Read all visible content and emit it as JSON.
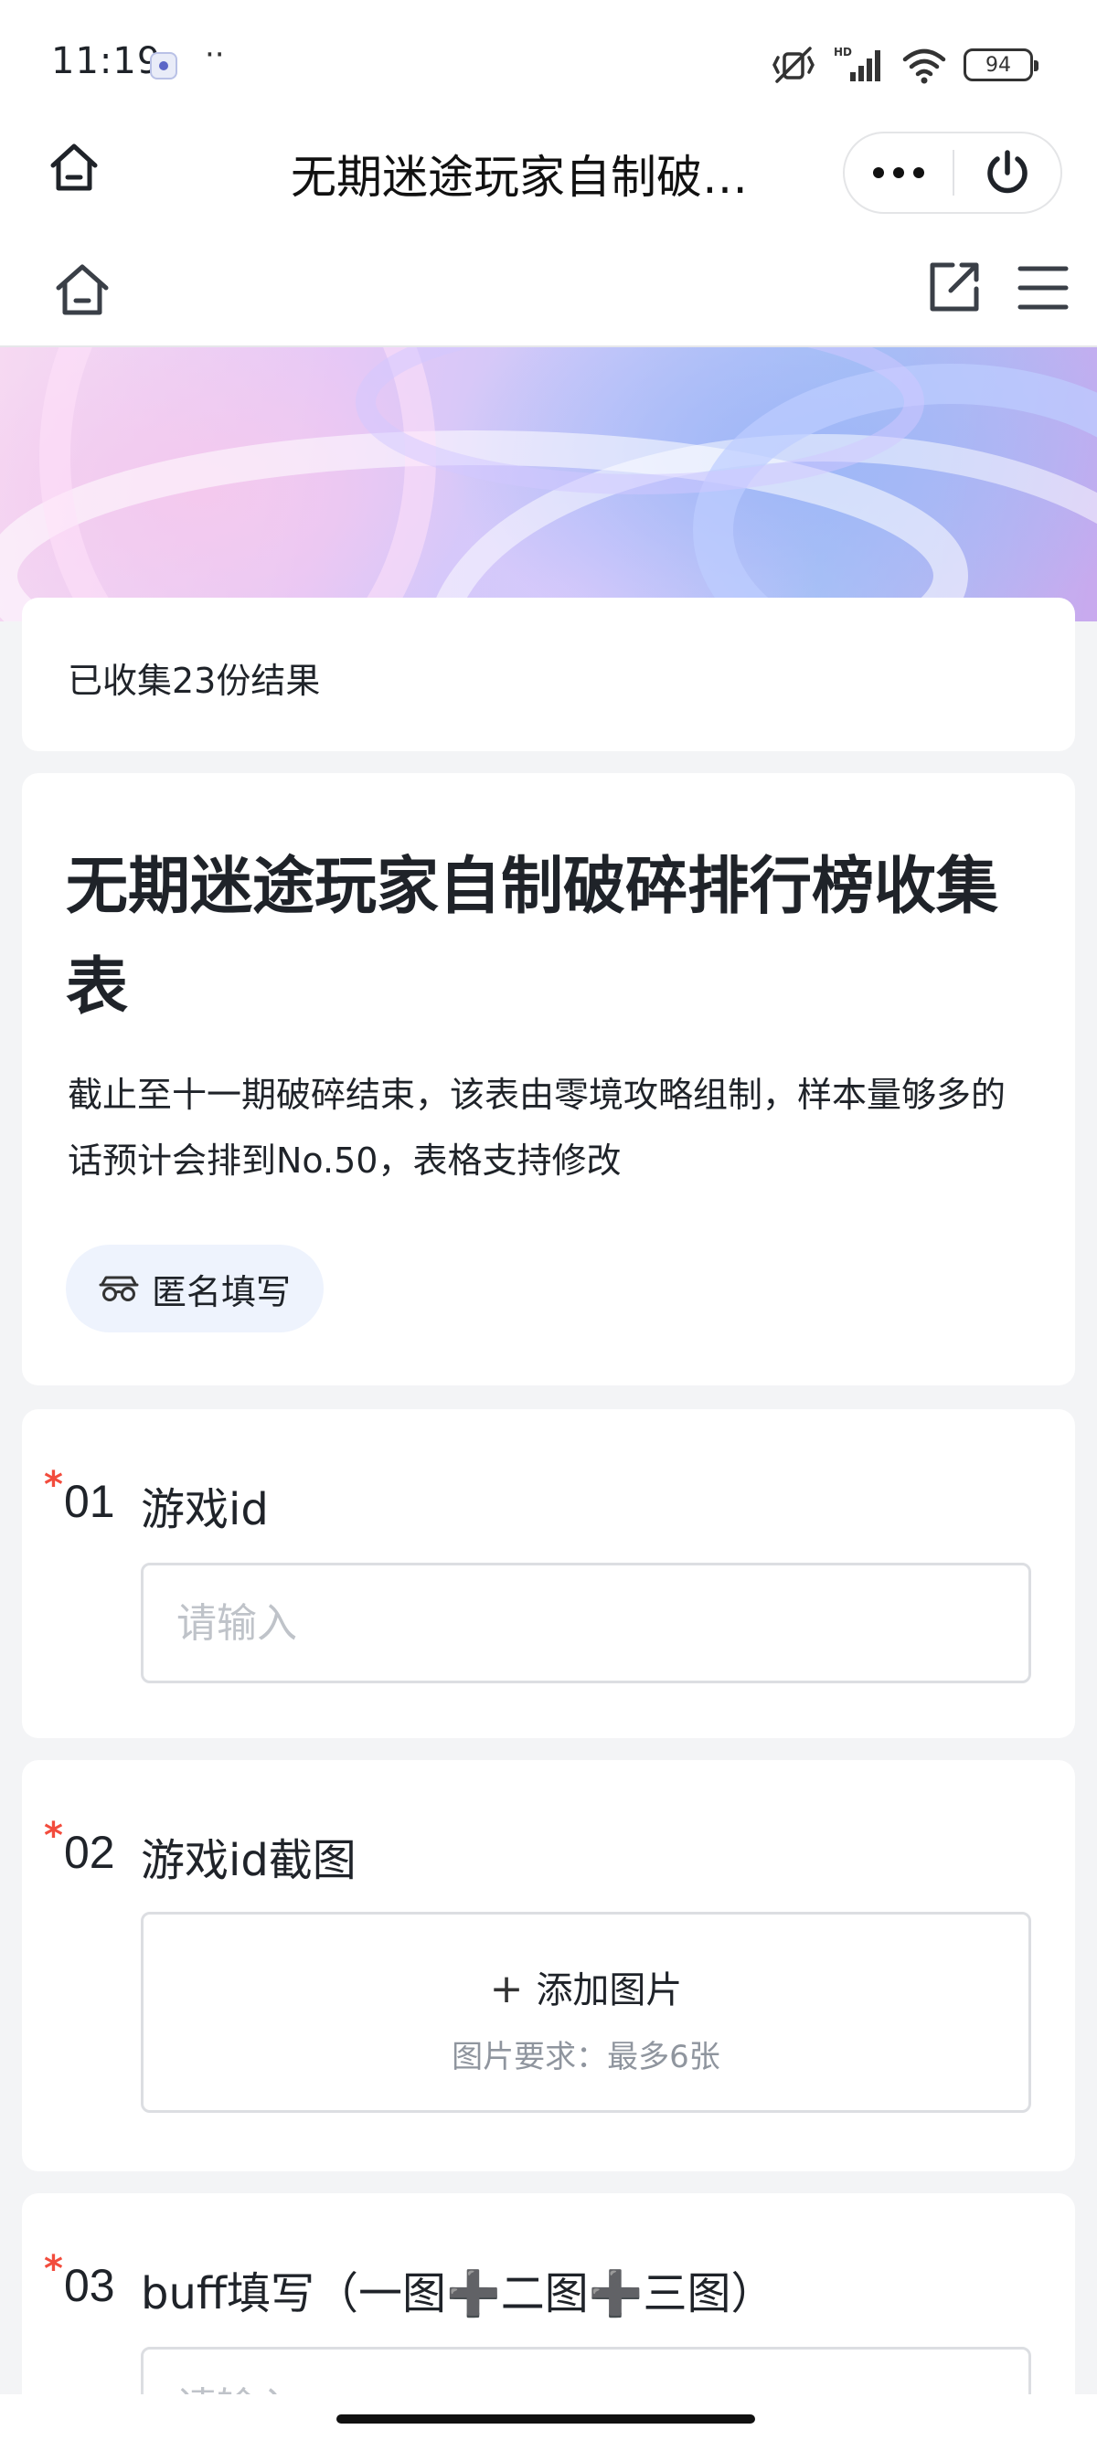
{
  "status_bar": {
    "time": "11:19",
    "dots": "··",
    "battery": "94"
  },
  "nav": {
    "title": "无期迷途玩家自制破…"
  },
  "banner": {
    "colors": [
      "#f6d9f2",
      "#c7c9fa",
      "#aac4f6"
    ]
  },
  "form": {
    "count_text": "已收集23份结果",
    "title": "无期迷途玩家自制破碎排行榜收集表",
    "description": "截止至十一期破碎结束，该表由零境攻略组制，样本量够多的话预计会排到No.50，表格支持修改",
    "anonymous_label": "匿名填写"
  },
  "questions": [
    {
      "required_mark": "*",
      "number": "01",
      "title": "游戏id",
      "placeholder": "请输入"
    },
    {
      "required_mark": "*",
      "number": "02",
      "title": "游戏id截图",
      "upload_label": "添加图片",
      "upload_hint": "图片要求：最多6张"
    },
    {
      "required_mark": "*",
      "number": "03",
      "title": "buff填写（一图➕二图➕三图）",
      "placeholder": "请输入"
    }
  ],
  "colors": {
    "accent_required": "#f24c3d",
    "chip_background": "#eef3fd",
    "page_background": "#f3f4f6"
  }
}
